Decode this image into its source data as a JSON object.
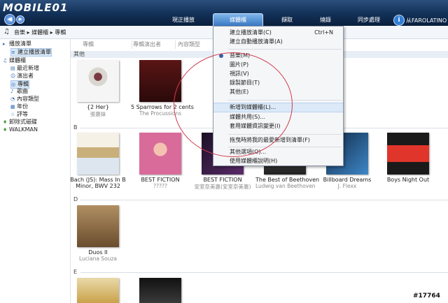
{
  "app": {
    "logo": "MOBILE01"
  },
  "nav": {
    "back": "◀",
    "forward": "▶"
  },
  "tabs": [
    {
      "label": "現正播放"
    },
    {
      "label": "媒體櫃"
    },
    {
      "label": "擷取"
    },
    {
      "label": "燒錄"
    },
    {
      "label": "同步處理"
    }
  ],
  "user": {
    "name": "从FAROLATINO"
  },
  "breadcrumb": {
    "text": "音樂 ▸ 媒體櫃 ▸ 專輯"
  },
  "sidebar": {
    "items": [
      {
        "label": "播放清單"
      },
      {
        "label": "建立播放清單"
      },
      {
        "label": "媒體櫃"
      },
      {
        "label": "最近新增"
      },
      {
        "label": "演出者"
      },
      {
        "label": "專輯"
      },
      {
        "label": "歌曲"
      },
      {
        "label": "內容類型"
      },
      {
        "label": "年份"
      },
      {
        "label": "評等"
      },
      {
        "label": "卸除式磁碟"
      },
      {
        "label": "WALKMAN"
      }
    ]
  },
  "columns": [
    {
      "label": "專輯"
    },
    {
      "label": "專輯演出者"
    },
    {
      "label": "內容類型"
    }
  ],
  "groups": [
    {
      "label": "其他"
    },
    {
      "label": "B"
    },
    {
      "label": "D"
    },
    {
      "label": "E"
    }
  ],
  "albums": [
    {
      "title": "{2 Her}",
      "artist": "張惠妹",
      "color": "#f1f1f1"
    },
    {
      "title": "5 Sparrows for 2 cents",
      "artist": "The Procussions",
      "color": "#6b1f1f"
    },
    {
      "title": "Bach (JS): Mass In B",
      "title2": "Minor, BWV 232",
      "artist": "",
      "color": "#e7ecf3"
    },
    {
      "title": "BEST FICTION",
      "artist": "?????",
      "color": "#d96b9a"
    },
    {
      "title": "BEST FICTION",
      "artist": "安室奈美惠(安室奈美惠)",
      "color": "#2d1a3a"
    },
    {
      "title": "The Best of Beethoven",
      "artist": "Ludwig van Beethoven",
      "color": "#3b3b3b"
    },
    {
      "title": "Billboard Dreams",
      "artist": "J. Flexx",
      "color": "#2a5c89"
    },
    {
      "title": "Boys Night Out",
      "artist": "",
      "color": "#e0352b"
    },
    {
      "title": "Duos II",
      "artist": "Luciana Souza",
      "color": "#8a6a45"
    },
    {
      "title": "",
      "artist": "",
      "color": "#c9a24a"
    },
    {
      "title": "",
      "artist": "",
      "color": "#1b1b1b"
    }
  ],
  "menu": {
    "items": [
      {
        "label": "建立播放清單(C)",
        "shortcut": "Ctrl+N"
      },
      {
        "label": "建立自動播放清單(A)",
        "shortcut": ""
      },
      {
        "label": "音樂(M)",
        "shortcut": "",
        "selected": true
      },
      {
        "label": "圖片(P)",
        "shortcut": ""
      },
      {
        "label": "視訊(V)",
        "shortcut": ""
      },
      {
        "label": "錄製節目(T)",
        "shortcut": ""
      },
      {
        "label": "其他(E)",
        "shortcut": ""
      },
      {
        "label": "新增到媒體櫃(L)...",
        "shortcut": ""
      },
      {
        "label": "媒體共用(S)...",
        "shortcut": ""
      },
      {
        "label": "套用媒體資訊變更(I)",
        "shortcut": ""
      },
      {
        "label": "拖曳時將我的最愛新增到清單(F)",
        "shortcut": ""
      },
      {
        "label": "其他選項(O)...",
        "shortcut": ""
      },
      {
        "label": "使用媒體櫃說明(H)",
        "shortcut": ""
      }
    ]
  },
  "watermark": {
    "text": "#17764"
  },
  "colors": {
    "accent": "#3a78c2",
    "circle": "#cf3b4b",
    "topbar": "#123057"
  }
}
